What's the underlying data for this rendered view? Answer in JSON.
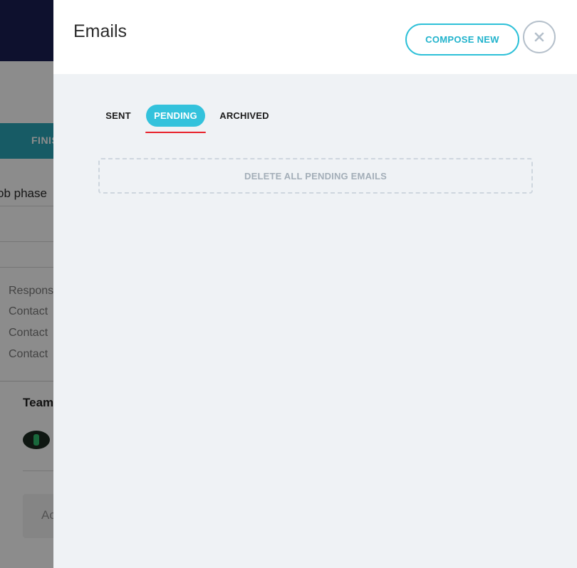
{
  "background": {
    "tab_label": "FINIS",
    "phase_label": "ob phase",
    "rows": [
      "Respons",
      "Contact",
      "Contact",
      "Contact"
    ],
    "team_label": "Team",
    "add_label": "Ac"
  },
  "panel": {
    "title": "Emails",
    "compose_label": "COMPOSE NEW",
    "close_icon": "close-icon"
  },
  "tabs": [
    {
      "label": "SENT",
      "active": false
    },
    {
      "label": "PENDING",
      "active": true
    },
    {
      "label": "ARCHIVED",
      "active": false
    }
  ],
  "actions": {
    "delete_all_label": "DELETE ALL PENDING EMAILS"
  },
  "colors": {
    "accent": "#33c2dc",
    "active_underline": "#e8202a",
    "panel_background": "#eff2f5",
    "nav_background": "#1b1f54"
  }
}
